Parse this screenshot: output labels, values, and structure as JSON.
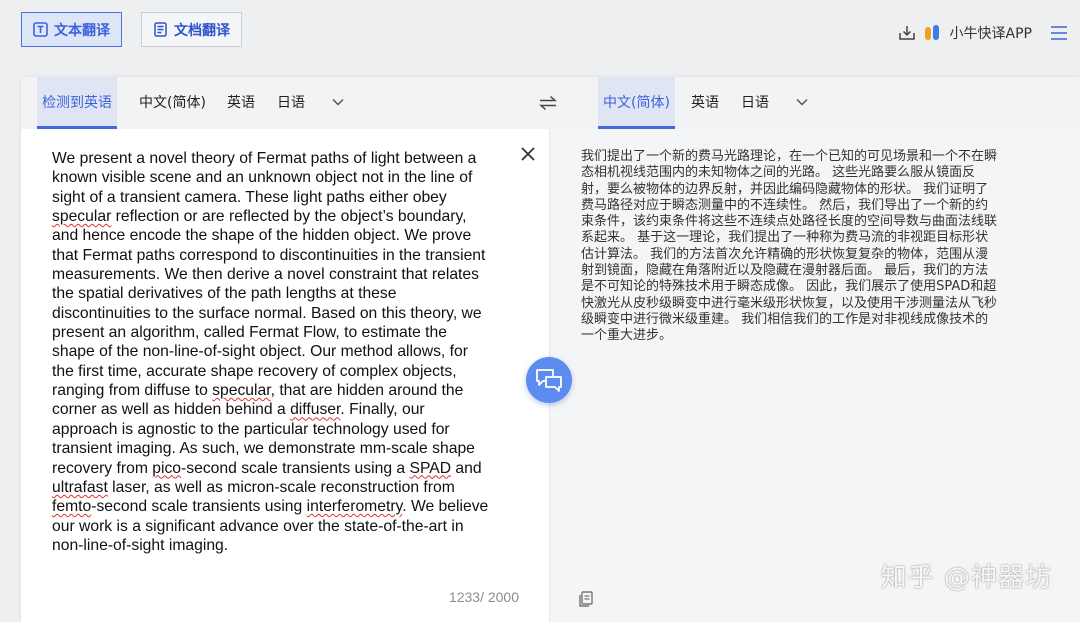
{
  "toolbar": {
    "text_translate_label": "文本翻译",
    "doc_translate_label": "文档翻译",
    "app_label": "小牛快译APP",
    "download_icon": "download-icon",
    "menu_icon": "hamburger-menu-icon"
  },
  "source_langs": {
    "detected": "检测到英语",
    "items": [
      "中文(简体)",
      "英语",
      "日语"
    ]
  },
  "target_langs": {
    "items": [
      "中文(简体)",
      "英语",
      "日语"
    ]
  },
  "source": {
    "lines": [
      [
        {
          "t": "We present a novel theory of Fermat paths of light between a"
        }
      ],
      [
        {
          "t": "known visible scene and an unknown object not in the line of"
        }
      ],
      [
        {
          "t": "sight of a transient camera. These light paths either obey"
        }
      ],
      [
        {
          "t": "specular",
          "s": true
        },
        {
          "t": " reflection or are reflected by the object’s boundary,"
        }
      ],
      [
        {
          "t": "and hence encode the shape of the hidden object. We prove"
        }
      ],
      [
        {
          "t": "that Fermat paths correspond to discontinuities in the transient"
        }
      ],
      [
        {
          "t": "measurements. We then derive a novel constraint that relates"
        }
      ],
      [
        {
          "t": "the spatial derivatives of the path lengths at these"
        }
      ],
      [
        {
          "t": "discontinuities to the surface normal. Based on this theory, we"
        }
      ],
      [
        {
          "t": "present an algorithm, called Fermat Flow, to estimate the"
        }
      ],
      [
        {
          "t": "shape of the non-line-of-sight object. Our method allows, for"
        }
      ],
      [
        {
          "t": "the first time, accurate shape recovery of complex objects,"
        }
      ],
      [
        {
          "t": "ranging from diffuse to "
        },
        {
          "t": "specular",
          "s": true
        },
        {
          "t": ", that are hidden around the"
        }
      ],
      [
        {
          "t": "corner as well as hidden behind a "
        },
        {
          "t": "diffuser",
          "s": true
        },
        {
          "t": ". Finally, our"
        }
      ],
      [
        {
          "t": "approach is agnostic to the particular technology used for"
        }
      ],
      [
        {
          "t": "transient imaging. As such, we demonstrate mm-scale shape"
        }
      ],
      [
        {
          "t": "recovery from "
        },
        {
          "t": "pico",
          "s": true
        },
        {
          "t": "-second scale transients using a "
        },
        {
          "t": "SPAD",
          "s": true
        },
        {
          "t": " and"
        }
      ],
      [
        {
          "t": "ultrafast",
          "s": true
        },
        {
          "t": " laser, as well as micron-scale reconstruction from"
        }
      ],
      [
        {
          "t": "femto",
          "s": true
        },
        {
          "t": "-second scale transients using "
        },
        {
          "t": "interferometry",
          "s": true
        },
        {
          "t": ". We believe"
        }
      ],
      [
        {
          "t": "our work is a significant advance over the state-of-the-art in"
        }
      ],
      [
        {
          "t": "non-line-of-sight imaging."
        }
      ]
    ],
    "char_count": "1233/ 2000"
  },
  "target": {
    "lines": [
      "我们提出了一个新的费马光路理论，在一个已知的可见场景和一个不在瞬",
      "态相机视线范围内的未知物体之间的光路。 这些光路要么服从镜面反",
      "射，要么被物体的边界反射，并因此编码隐藏物体的形状。 我们证明了",
      "费马路径对应于瞬态测量中的不连续性。 然后，我们导出了一个新的约",
      "束条件，该约束条件将这些不连续点处路径长度的空间导数与曲面法线联",
      "系起来。 基于这一理论，我们提出了一种称为费马流的非视距目标形状",
      "估计算法。 我们的方法首次允许精确的形状恢复复杂的物体，范围从漫",
      "射到镜面，隐藏在角落附近以及隐藏在漫射器后面。 最后，我们的方法",
      "是不可知论的特殊技术用于瞬态成像。 因此，我们展示了使用SPAD和超",
      "快激光从皮秒级瞬变中进行毫米级形状恢复，以及使用干涉测量法从飞秒",
      "级瞬变中进行微米级重建。 我们相信我们的工作是对非视线成像技术的",
      "一个重大进步。"
    ]
  },
  "watermark": "知乎 @神器坊",
  "colors": {
    "accent": "#3d63dd",
    "fab": "#5c8cf0"
  }
}
